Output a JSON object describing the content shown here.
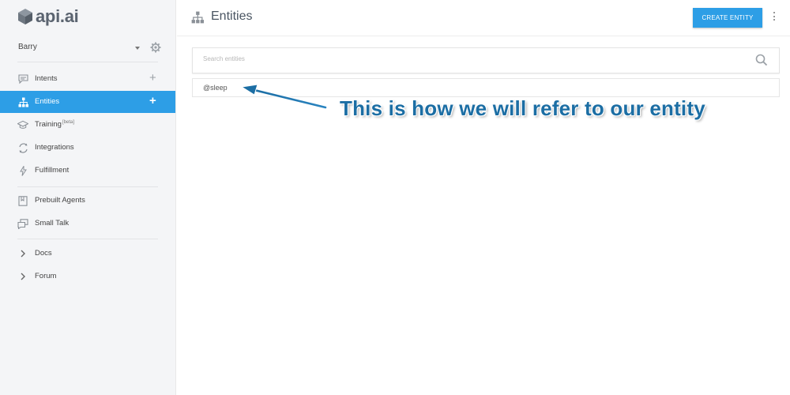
{
  "app": {
    "logo_text": "api.ai"
  },
  "agent": {
    "name": "Barry"
  },
  "sidebar": {
    "items": [
      {
        "label": "Intents",
        "icon": "speech-bubble-icon",
        "has_add": true,
        "active": false
      },
      {
        "label": "Entities",
        "icon": "hierarchy-icon",
        "has_add": true,
        "active": true
      },
      {
        "label": "Training",
        "badge": "[beta]",
        "icon": "graduation-cap-icon",
        "has_add": false,
        "active": false
      },
      {
        "label": "Integrations",
        "icon": "integrations-icon",
        "has_add": false,
        "active": false
      },
      {
        "label": "Fulfillment",
        "icon": "lightning-bolt-icon",
        "has_add": false,
        "active": false
      },
      {
        "label": "Prebuilt Agents",
        "icon": "book-icon",
        "has_add": false,
        "active": false
      },
      {
        "label": "Small Talk",
        "icon": "chat-bubbles-icon",
        "has_add": false,
        "active": false
      },
      {
        "label": "Docs",
        "icon": "chevron-right-icon",
        "has_add": false,
        "active": false
      },
      {
        "label": "Forum",
        "icon": "chevron-right-icon",
        "has_add": false,
        "active": false
      }
    ],
    "add_symbol": "+"
  },
  "header": {
    "title": "Entities",
    "create_button_label": "CREATE ENTITY"
  },
  "search": {
    "placeholder": "Search entities",
    "value": ""
  },
  "entities": [
    {
      "name": "@sleep"
    }
  ],
  "annotation": {
    "text": "This is how we will refer to our entity"
  },
  "colors": {
    "accent": "#2d9ee6",
    "annotation": "#1c6ea4",
    "sidebar_bg": "#f4f5f7"
  }
}
